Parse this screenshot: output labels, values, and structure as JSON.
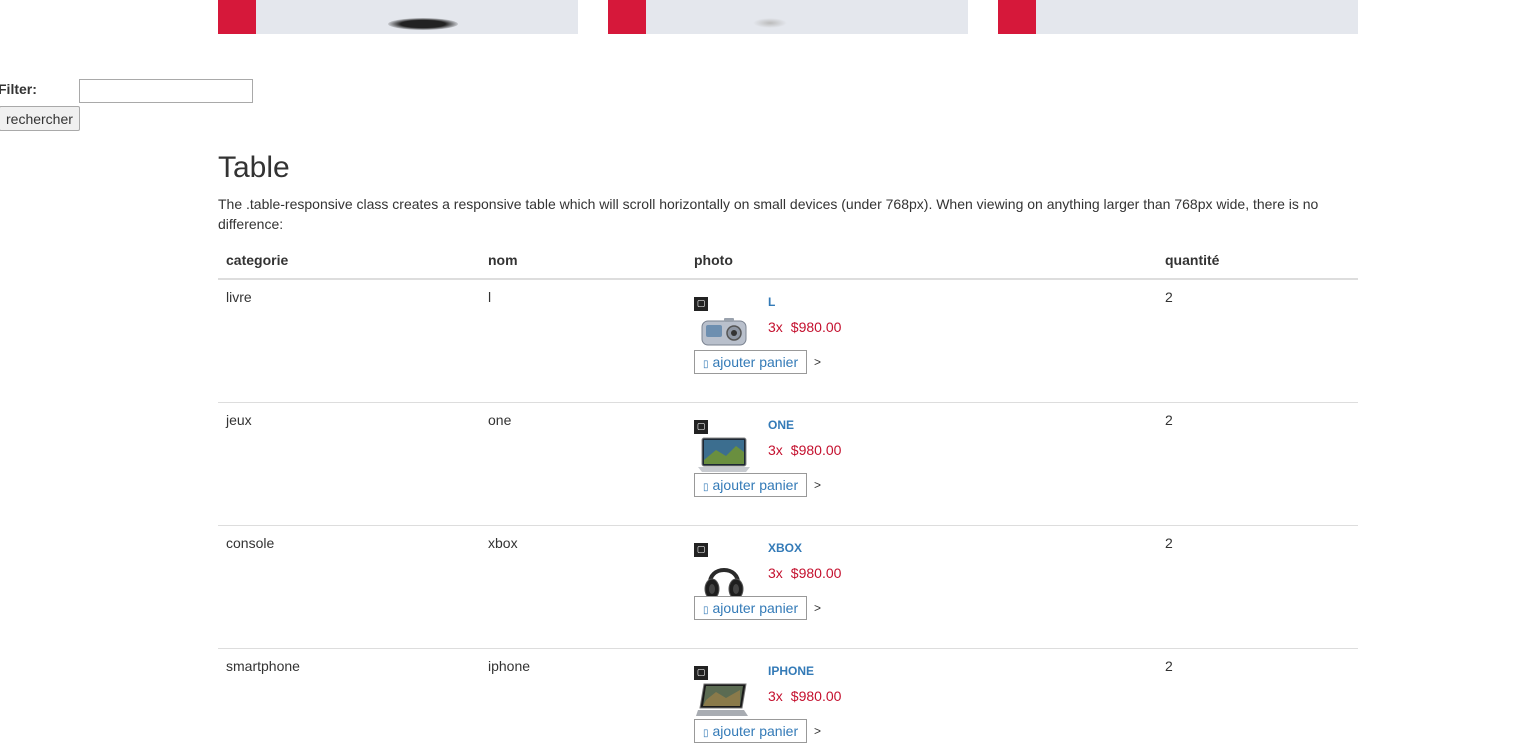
{
  "banner": {
    "accent_color": "#d6183a",
    "card_color": "#e4e7ed"
  },
  "filter": {
    "label": "Filter:",
    "input_value": "",
    "search_label": "rechercher"
  },
  "section": {
    "title": "Table",
    "description": "The .table-responsive class creates a responsive table which will scroll horizontally on small devices (under 768px). When viewing on anything larger than 768px wide, there is no difference:"
  },
  "table": {
    "headers": [
      "categorie",
      "nom",
      "photo",
      "quantité"
    ],
    "rows": [
      {
        "categorie": "livre",
        "nom": "l",
        "product_name": "L",
        "product_qty": "3x",
        "product_price": "$980.00",
        "product_icon": "camera-icon",
        "add_label": "ajouter panier",
        "more": ">",
        "quantite": "2"
      },
      {
        "categorie": "jeux",
        "nom": "one",
        "product_name": "ONE",
        "product_qty": "3x",
        "product_price": "$980.00",
        "product_icon": "laptop-icon",
        "add_label": "ajouter panier",
        "more": ">",
        "quantite": "2"
      },
      {
        "categorie": "console",
        "nom": "xbox",
        "product_name": "XBOX",
        "product_qty": "3x",
        "product_price": "$980.00",
        "product_icon": "headphones-icon",
        "add_label": "ajouter panier",
        "more": ">",
        "quantite": "2"
      },
      {
        "categorie": "smartphone",
        "nom": "iphone",
        "product_name": "IPHONE",
        "product_qty": "3x",
        "product_price": "$980.00",
        "product_icon": "laptop-icon",
        "add_label": "ajouter panier",
        "more": ">",
        "quantite": "2"
      }
    ]
  },
  "colors": {
    "link": "#337ab7",
    "price": "#c4102e"
  }
}
